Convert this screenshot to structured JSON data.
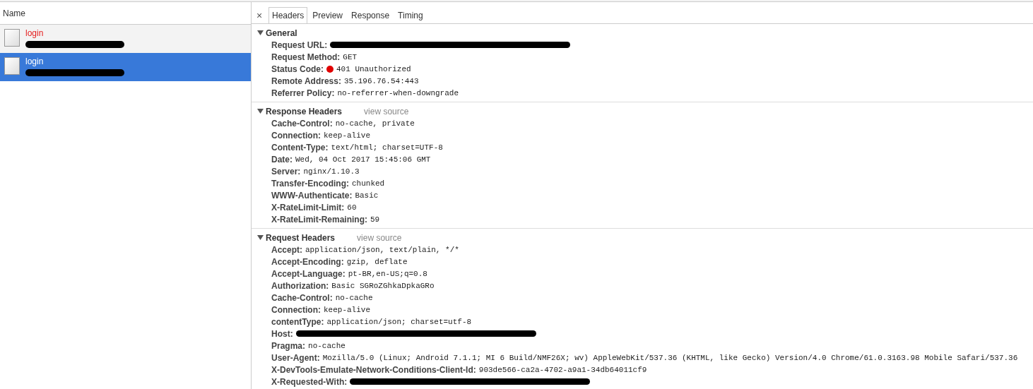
{
  "request_list": {
    "column_header": "Name",
    "items": [
      {
        "name": "login",
        "error": true,
        "selected": false,
        "subtitle_redacted": true
      },
      {
        "name": "login",
        "error": false,
        "selected": true,
        "subtitle_redacted": true
      }
    ]
  },
  "detail": {
    "close": "×",
    "tabs": [
      {
        "label": "Headers",
        "selected": true
      },
      {
        "label": "Preview",
        "selected": false
      },
      {
        "label": "Response",
        "selected": false
      },
      {
        "label": "Timing",
        "selected": false
      }
    ],
    "sections": [
      {
        "title": "General",
        "expanded": true,
        "rows": [
          {
            "key": "Request URL:",
            "redacted": true
          },
          {
            "key": "Request Method:",
            "value": "GET"
          },
          {
            "key": "Status Code:",
            "value": "401 Unauthorized",
            "color": "#e00000"
          },
          {
            "key": "Remote Address:",
            "value": "35.196.76.54:443"
          },
          {
            "key": "Referrer Policy:",
            "value": "no-referrer-when-downgrade"
          }
        ]
      },
      {
        "title": "Response Headers",
        "link": "view source",
        "expanded": true,
        "rows": [
          {
            "key": "Cache-Control:",
            "value": "no-cache, private"
          },
          {
            "key": "Connection:",
            "value": "keep-alive"
          },
          {
            "key": "Content-Type:",
            "value": "text/html; charset=UTF-8"
          },
          {
            "key": "Date:",
            "value": "Wed, 04 Oct 2017 15:45:06 GMT"
          },
          {
            "key": "Server:",
            "value": "nginx/1.10.3"
          },
          {
            "key": "Transfer-Encoding:",
            "value": "chunked"
          },
          {
            "key": "WWW-Authenticate:",
            "value": "Basic"
          },
          {
            "key": "X-RateLimit-Limit:",
            "value": "60"
          },
          {
            "key": "X-RateLimit-Remaining:",
            "value": "59"
          }
        ]
      },
      {
        "title": "Request Headers",
        "link": "view source",
        "expanded": true,
        "rows": [
          {
            "key": "Accept:",
            "value": "application/json, text/plain, */*"
          },
          {
            "key": "Accept-Encoding:",
            "value": "gzip, deflate"
          },
          {
            "key": "Accept-Language:",
            "value": "pt-BR,en-US;q=0.8"
          },
          {
            "key": "Authorization:",
            "value": "Basic SGRoZGhkaDpkaGRo"
          },
          {
            "key": "Cache-Control:",
            "value": "no-cache"
          },
          {
            "key": "Connection:",
            "value": "keep-alive"
          },
          {
            "key": "contentType:",
            "value": "application/json; charset=utf-8"
          },
          {
            "key": "Host:",
            "redacted": true
          },
          {
            "key": "Pragma:",
            "value": "no-cache"
          },
          {
            "key": "User-Agent:",
            "value": "Mozilla/5.0 (Linux; Android 7.1.1; MI 6 Build/NMF26X; wv) AppleWebKit/537.36 (KHTML, like Gecko) Version/4.0 Chrome/61.0.3163.98 Mobile Safari/537.36"
          },
          {
            "key": "X-DevTools-Emulate-Network-Conditions-Client-Id:",
            "value": "903de566-ca2a-4702-a9a1-34db64011cf9"
          },
          {
            "key": "X-Requested-With:",
            "redacted": true
          }
        ]
      }
    ]
  }
}
